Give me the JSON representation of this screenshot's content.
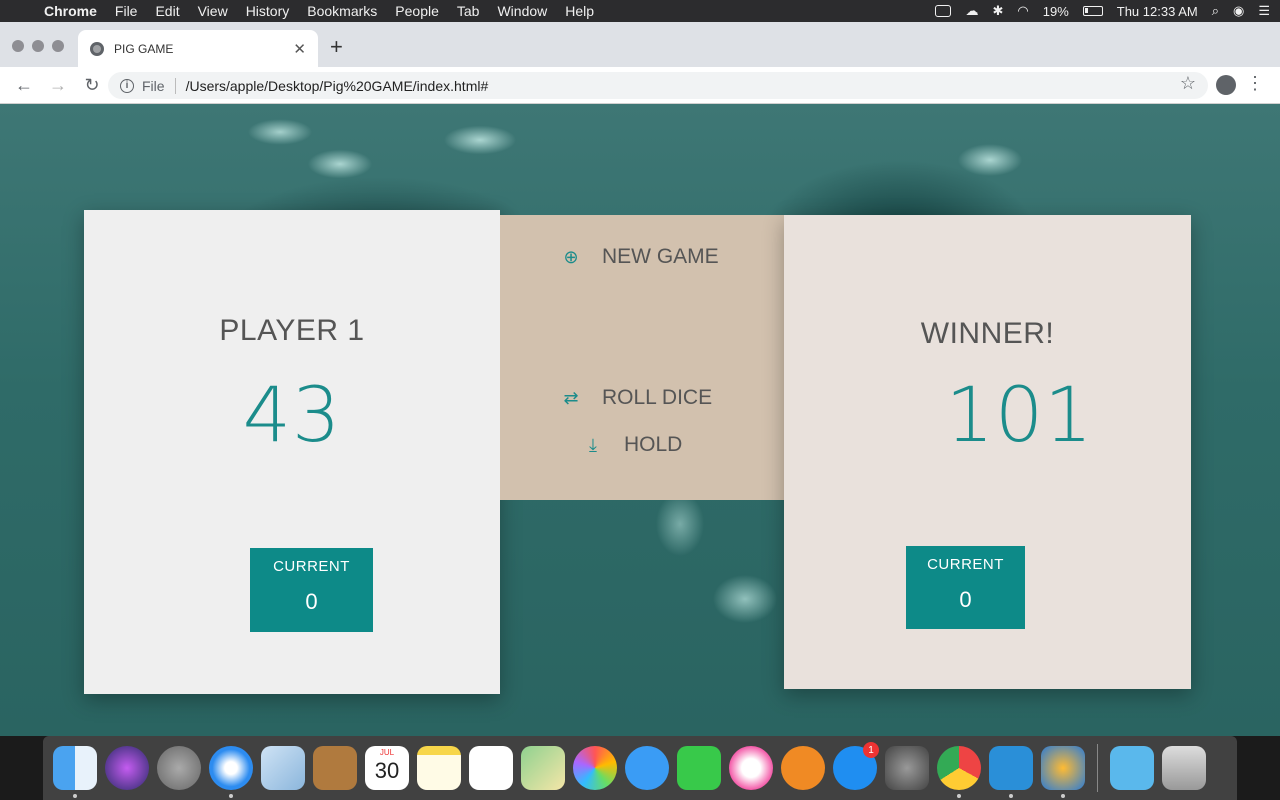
{
  "menubar": {
    "app": "Chrome",
    "items": [
      "File",
      "Edit",
      "View",
      "History",
      "Bookmarks",
      "People",
      "Tab",
      "Window",
      "Help"
    ],
    "battery": "19%",
    "clock": "Thu 12:33 AM"
  },
  "browser": {
    "tab_title": "PIG GAME",
    "url_scheme": "File",
    "url": "/Users/apple/Desktop/Pig%20GAME/index.html#"
  },
  "game": {
    "player1": {
      "name": "PLAYER 1",
      "score": "43",
      "current_label": "CURRENT",
      "current_value": "0"
    },
    "player2": {
      "name": "WINNER!",
      "score": "101",
      "current_label": "CURRENT",
      "current_value": "0"
    },
    "buttons": {
      "new_game": "NEW GAME",
      "roll_dice": "ROLL DICE",
      "hold": "HOLD"
    },
    "accent_color": "#0d8a88"
  },
  "dock": {
    "apps": [
      "finder-icon",
      "siri-icon",
      "launchpad-icon",
      "safari-icon",
      "mail-icon",
      "contacts-icon",
      "calendar-icon",
      "notes-icon",
      "reminders-icon",
      "maps-icon",
      "photos-icon",
      "messages-icon",
      "facetime-icon",
      "itunes-icon",
      "books-icon",
      "app-store-icon",
      "system-preferences-icon",
      "chrome-icon",
      "screen-tool-icon",
      "wunderlist-icon",
      "downloads-icon",
      "trash-icon"
    ],
    "calendar_month": "JUL",
    "calendar_day": "30",
    "app_store_badge": "1"
  }
}
